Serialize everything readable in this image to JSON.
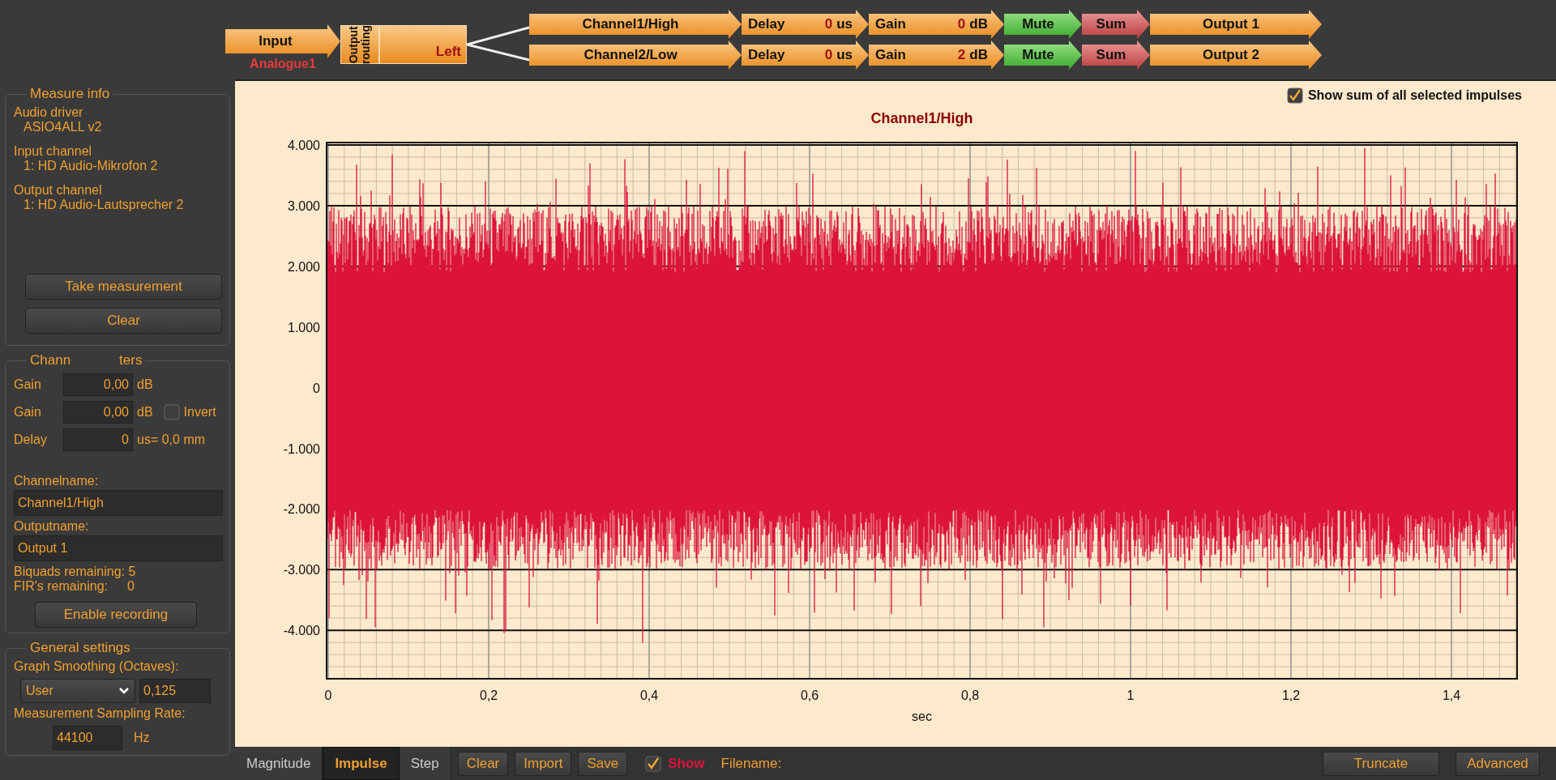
{
  "pipeline": {
    "input": {
      "label": "Input",
      "source": "Analogue1"
    },
    "routing": {
      "label": "Output routing",
      "side": "Left"
    },
    "channels": [
      {
        "name": "Channel1/High",
        "delay_label": "Delay",
        "delay": "0",
        "delay_unit": "us",
        "gain_label": "Gain",
        "gain": "0",
        "gain_unit": "dB",
        "mute": "Mute",
        "sum": "Sum",
        "output": "Output 1"
      },
      {
        "name": "Channel2/Low",
        "delay_label": "Delay",
        "delay": "0",
        "delay_unit": "us",
        "gain_label": "Gain",
        "gain": "2",
        "gain_unit": "dB",
        "mute": "Mute",
        "sum": "Sum",
        "output": "Output 2"
      }
    ]
  },
  "measure_info": {
    "title": "Measure info",
    "items": [
      {
        "label": "Audio driver",
        "value": "ASIO4ALL v2"
      },
      {
        "label": "Input channel",
        "value": "1: HD Audio-Mikrofon 2"
      },
      {
        "label": "Output channel",
        "value": "1: HD Audio-Lautsprecher 2"
      }
    ],
    "buttons": [
      "Take measurement",
      "Clear"
    ]
  },
  "channel_parameters": {
    "title_parts": [
      "Chann",
      "ters"
    ],
    "stray_gain": {
      "label": "Gain",
      "value": "0,00",
      "unit": "dB"
    },
    "gain": {
      "label": "Gain",
      "value": "0,00",
      "unit": "dB",
      "invert": {
        "label": "Invert",
        "checked": false
      }
    },
    "delay": {
      "label": "Delay",
      "value": "0",
      "unit": "us= 0,0 mm"
    },
    "channelname_label": "Channelname:",
    "channelname": "Channel1/High",
    "outputname_label": "Outputname:",
    "outputname": "Output 1",
    "biquads": "Biquads remaining: 5",
    "fir_label": "FIR's remaining:",
    "fir_value": "0",
    "button": "Enable recording"
  },
  "general_settings": {
    "title": "General settings",
    "smoothing_label": "Graph Smoothing (Octaves):",
    "smoothing_select": "User",
    "smoothing_value": "0,125",
    "rate_label": "Measurement Sampling Rate:",
    "rate": "44100",
    "rate_unit": "Hz"
  },
  "chart": {
    "show_sum": {
      "label": "Show sum of all selected impulses",
      "checked": true
    },
    "title": "Channel1/High",
    "yticks": [
      "4.000",
      "3.000",
      "2.000",
      "1.000",
      "0",
      "-1.000",
      "-2.000",
      "-3.000",
      "-4.000"
    ],
    "xticks": [
      "0",
      "0,2",
      "0,4",
      "0,6",
      "0,8",
      "1",
      "1,2",
      "1,4"
    ],
    "xlabel": "sec"
  },
  "bottom_bar": {
    "tabs": [
      {
        "label": "Magnitude",
        "selected": false
      },
      {
        "label": "Impulse",
        "selected": true
      },
      {
        "label": "Step",
        "selected": false
      }
    ],
    "buttons": [
      "Clear",
      "Import",
      "Save"
    ],
    "show": {
      "label": "Show",
      "checked": true
    },
    "filename_label": "Filename:",
    "right_buttons": [
      "Truncate",
      "Advanced"
    ]
  }
}
